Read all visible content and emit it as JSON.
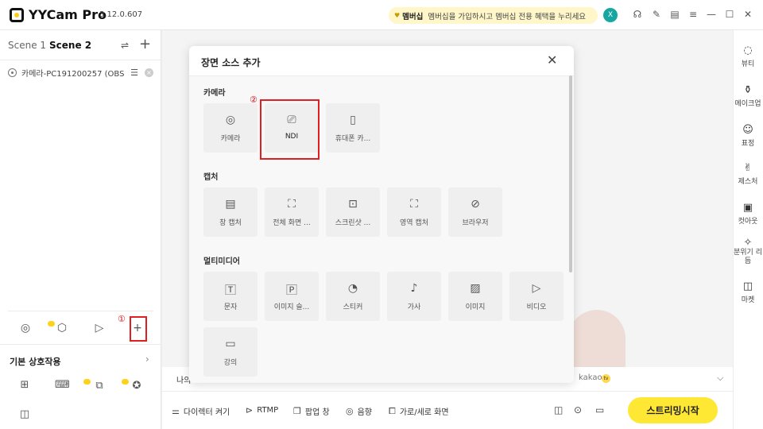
{
  "titlebar": {
    "app_name": "YYCam Pro",
    "version": "3.12.0.607",
    "membership_label": "멤버십",
    "membership_text": "멤버십을 가입하시고 멤버십 전용 혜택을 누리세요",
    "avatar_initial": "X",
    "accent_color": "#17a7a0"
  },
  "scenes": {
    "tabs": [
      "Scene 1",
      "Scene 2"
    ],
    "active": "Scene 2",
    "sources": [
      "카메라-PC191200257 (OBS ..."
    ]
  },
  "left_panel": {
    "basic_interaction_label": "기본 상호작용",
    "annotation_1": "①"
  },
  "modal": {
    "title": "장면 소스 추가",
    "annotation_2": "②",
    "sections": [
      {
        "title": "카메라",
        "items": [
          "카메라",
          "NDI",
          "휴대폰 카..."
        ]
      },
      {
        "title": "캡처",
        "items": [
          "창 캡처",
          "전체 화면 ...",
          "스크린샷 ...",
          "영역 캡처",
          "브라우저"
        ]
      },
      {
        "title": "멀티미디어",
        "items": [
          "문자",
          "이미지 슬...",
          "스티커",
          "가사",
          "이미지",
          "비디오",
          "강의"
        ]
      }
    ]
  },
  "platform_bar": {
    "my_label": "나의",
    "kakao": "kakao"
  },
  "bottom_bar": {
    "director": "다이렉터 켜기",
    "rtmp": "RTMP",
    "popup": "팝업 창",
    "audio": "음향",
    "orientation": "가로/세로 화면",
    "stream_button": "스트리밍시작"
  },
  "right_sidebar": [
    "뷰티",
    "메이크업",
    "표정",
    "제스처",
    "컷아웃",
    "분위기 리듬",
    "마켓"
  ]
}
